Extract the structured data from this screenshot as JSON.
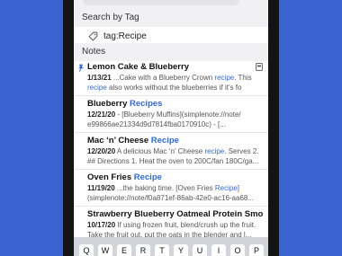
{
  "search_tag_section": {
    "header": "Search by Tag",
    "tag": "tag:Recipe",
    "tag_icon": "tag-icon"
  },
  "notes_section": {
    "header": "Notes",
    "items": [
      {
        "title": "Lemon Cake & Blueberry",
        "date": "1/13/21",
        "line1": " ...Cake with a Blueberry Crown ",
        "line1_hl": "recipe",
        "line1_end": ". This",
        "line2_hl": "recipe",
        "line2": " also works without the blueberries if it's fo",
        "pinned": true,
        "has_attachment": true
      },
      {
        "title_pre": "Blueberry ",
        "title_hl": "Recipes",
        "date": "12/21/20",
        "line1": " - [Blueberry Muffins](simplenote://note/",
        "line2": "e99866ae21334d9d7814fba0170910c) - [..."
      },
      {
        "title_pre": "Mac ‘n’ Cheese ",
        "title_hl": "Recipe",
        "date": "12/20/20",
        "line1": " A delicious Mac ‘n’ Cheese ",
        "line1_hl": "recipe",
        "line1_end": ". Serves 2.",
        "line2": "## Directions 1. Heat the oven to 200C/fan 180C/ga..."
      },
      {
        "title_pre": "Oven Fries ",
        "title_hl": "Recipe",
        "date": "11/19/20",
        "line1": " ...the baking time. [Oven Fries ",
        "line1_hl": "Recipe",
        "line1_end": "]",
        "line2": "(simplenote://note/f0a871ef-86ab-42e0-ac16-aa68..."
      },
      {
        "title": "Strawberry Blueberry Oatmeal Protein Smoo...",
        "date": "10/17/20",
        "line1": " If using frozen fruit, blend/crush up the fruit.",
        "line2": "Take the fruit out, put the oats in the blender and l..."
      }
    ]
  },
  "keyboard": {
    "keys": [
      "Q",
      "W",
      "E",
      "R",
      "T",
      "Y",
      "U",
      "I",
      "O",
      "P"
    ]
  }
}
